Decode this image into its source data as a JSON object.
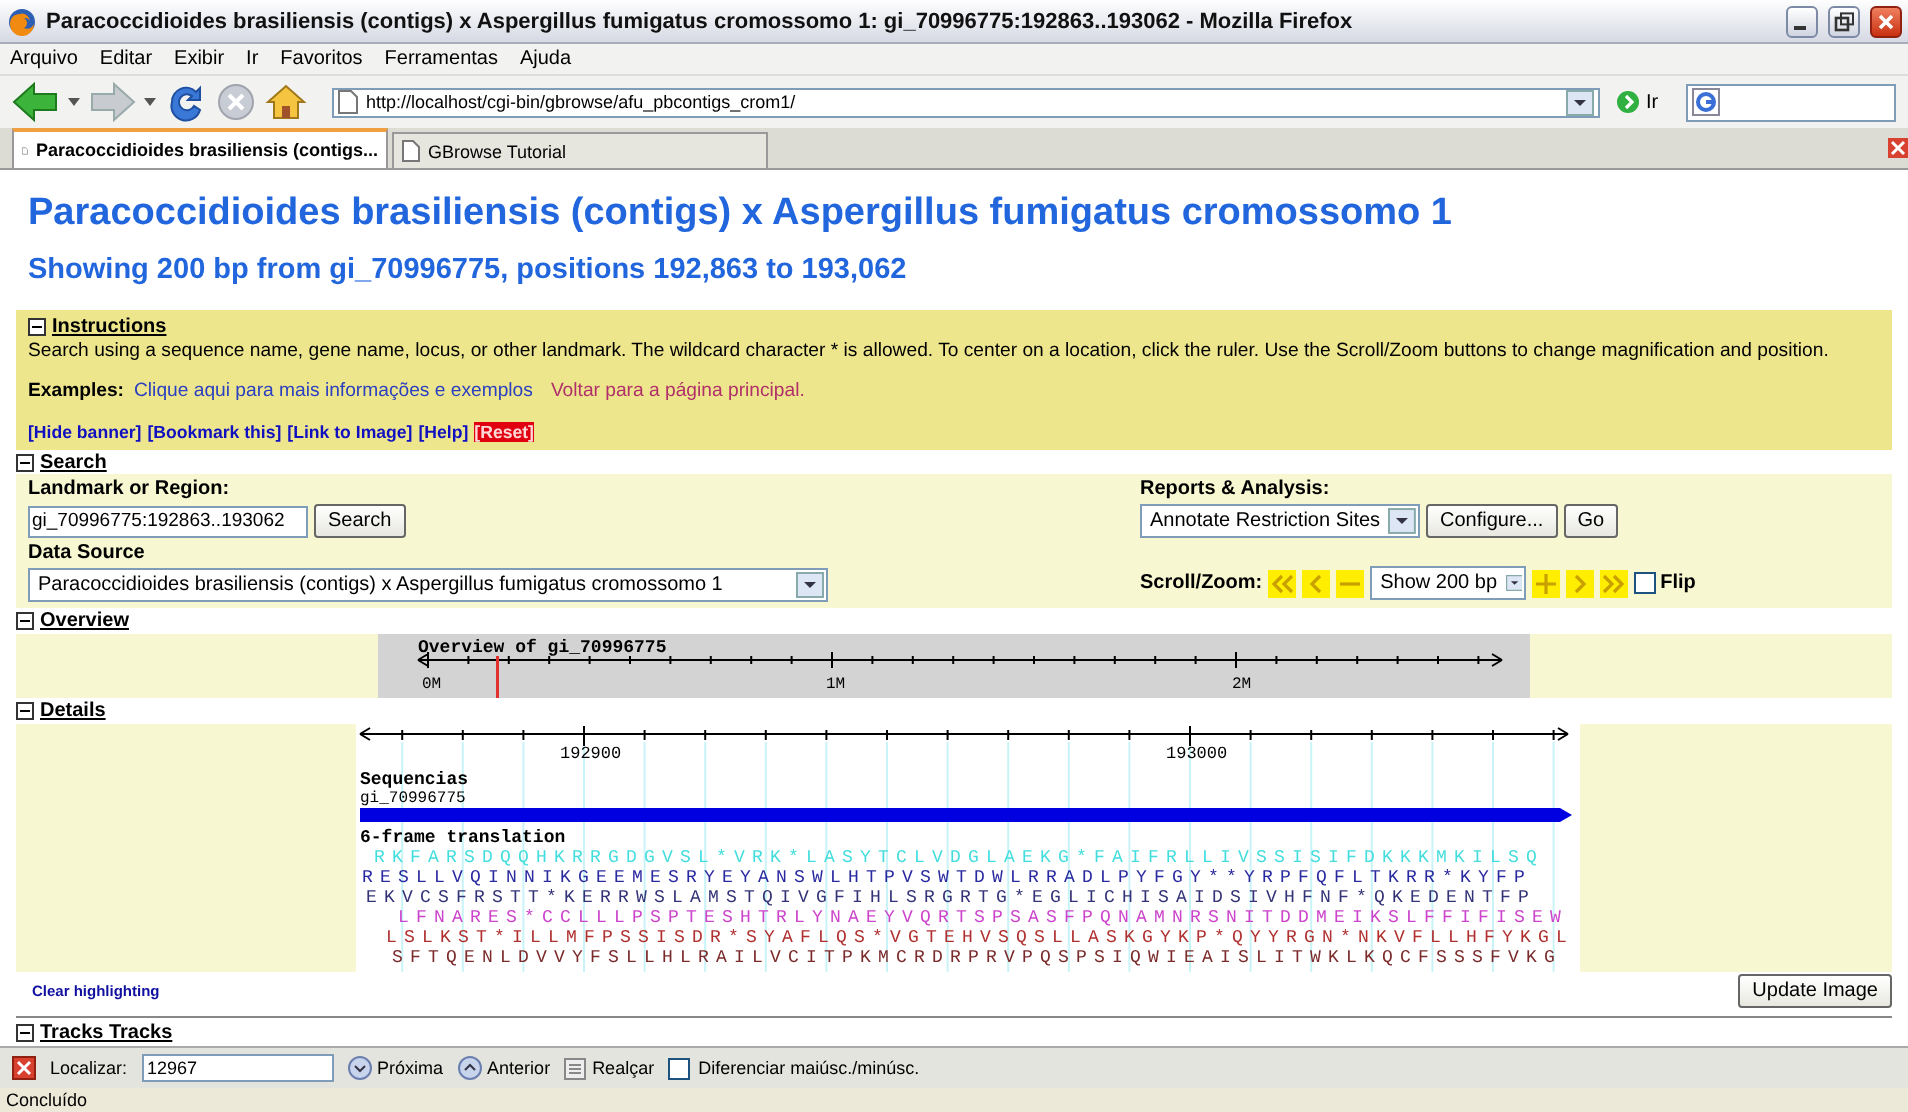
{
  "window": {
    "title": "Paracoccidioides brasiliensis (contigs) x Aspergillus fumigatus cromossomo 1: gi_70996775:192863..193062 - Mozilla Firefox"
  },
  "menu": [
    "Arquivo",
    "Editar",
    "Exibir",
    "Ir",
    "Favoritos",
    "Ferramentas",
    "Ajuda"
  ],
  "address": {
    "value": "http://localhost/cgi-bin/gbrowse/afu_pbcontigs_crom1/",
    "go": "Ir"
  },
  "tabs": [
    {
      "label": "Paracoccidioides brasiliensis (contigs...",
      "selected": true
    },
    {
      "label": "GBrowse Tutorial",
      "selected": false
    }
  ],
  "page": {
    "title": "Paracoccidioides brasiliensis (contigs) x Aspergillus fumigatus cromossomo 1",
    "subtitle": "Showing 200 bp from gi_70996775, positions 192,863 to 193,062"
  },
  "instructions": {
    "header": "Instructions",
    "expanded": true,
    "text": "Search using a sequence name, gene name, locus, or other landmark. The wildcard character * is allowed. To center on a location, click the ruler. Use the Scroll/Zoom buttons to change magnification and position.",
    "examples_label": "Examples:",
    "examples_link": "Clique aqui para mais informações e exemplos",
    "back_link": "Voltar para a página principal."
  },
  "links": [
    {
      "label": "[Hide banner]",
      "kind": "link"
    },
    {
      "label": "[Bookmark this]",
      "kind": "link"
    },
    {
      "label": "[Link to Image]",
      "kind": "link"
    },
    {
      "label": "[Help]",
      "kind": "link"
    },
    {
      "label": "[Reset]",
      "kind": "reset"
    }
  ],
  "search": {
    "header": "Search",
    "expanded": true,
    "landmark_label": "Landmark or Region:",
    "landmark_value": "gi_70996775:192863..193062",
    "search_button": "Search",
    "source_label": "Data Source",
    "source_value": "Paracoccidioides brasiliensis (contigs) x Aspergillus fumigatus cromossomo 1",
    "reports_label": "Reports & Analysis:",
    "reports_value": "Annotate Restriction Sites",
    "configure_button": "Configure...",
    "go_button": "Go",
    "scroll_label": "Scroll/Zoom:",
    "zoom_value": "Show 200 bp",
    "flip": {
      "label": "Flip",
      "checked": false
    }
  },
  "overview": {
    "header": "Overview",
    "expanded": true,
    "title": "Overview of gi_70996775",
    "ticks": [
      "0M",
      "1M",
      "2M"
    ]
  },
  "details": {
    "header": "Details",
    "expanded": true,
    "ticks": [
      "192900",
      "193000"
    ],
    "track_label": "Sequencias",
    "track_name": "gi_70996775",
    "translation_label": "6-frame translation",
    "frames": [
      {
        "sequence": "RKFARSDQQHKRRGDGVSL*VRK*LASYTCLVDGLAEKG*FAIFRLLIVSSISIFDKKKMKILSQ",
        "color": "#44dddd"
      },
      {
        "sequence": "RESLLVQINNIKGEEMESRYEYANSWLHTPVSWTDWLRRADLPYFGY**YRPFQFLTKRR*KYFP",
        "color": "#2a2aa0"
      },
      {
        "sequence": "EKVCSFRSTT*KERRWSLAMSTQIVGFIHLSRGRTG*EGLICHISAIDSIVHFNF*QKEDENTFP",
        "color": "#333377"
      },
      {
        "sequence": "LFNARES*CCLLLPSPTESHTRLYNAEYVQRTSPSASFPQNAMNRSNITDDMEIKSLFFIFISEW",
        "color": "#cc44cc"
      },
      {
        "sequence": "LSLKST*ILLMFPSSISDR*SYAFLQS*VGTEHVSQSLLASKGYKP*QYYRGN*NKVFLLHFYKGL",
        "color": "#b03030"
      },
      {
        "sequence": "SFTQENLDVVYFSLLHLRAILVCITPKMCRDRPRVPQSPSIQWIEAISLITWKLKQCFSSSFVKG",
        "color": "#7a2a2a"
      }
    ]
  },
  "clear_link": "Clear highlighting",
  "update_button": "Update Image",
  "tracks": {
    "header": "Tracks Tracks",
    "expanded": true
  },
  "findbar": {
    "label": "Localizar:",
    "value": "12967",
    "next": "Próxima",
    "prev": "Anterior",
    "highlight": "Realçar",
    "match_case": {
      "label": "Diferenciar maiúsc./minúsc.",
      "checked": false
    }
  },
  "status": "Concluído"
}
